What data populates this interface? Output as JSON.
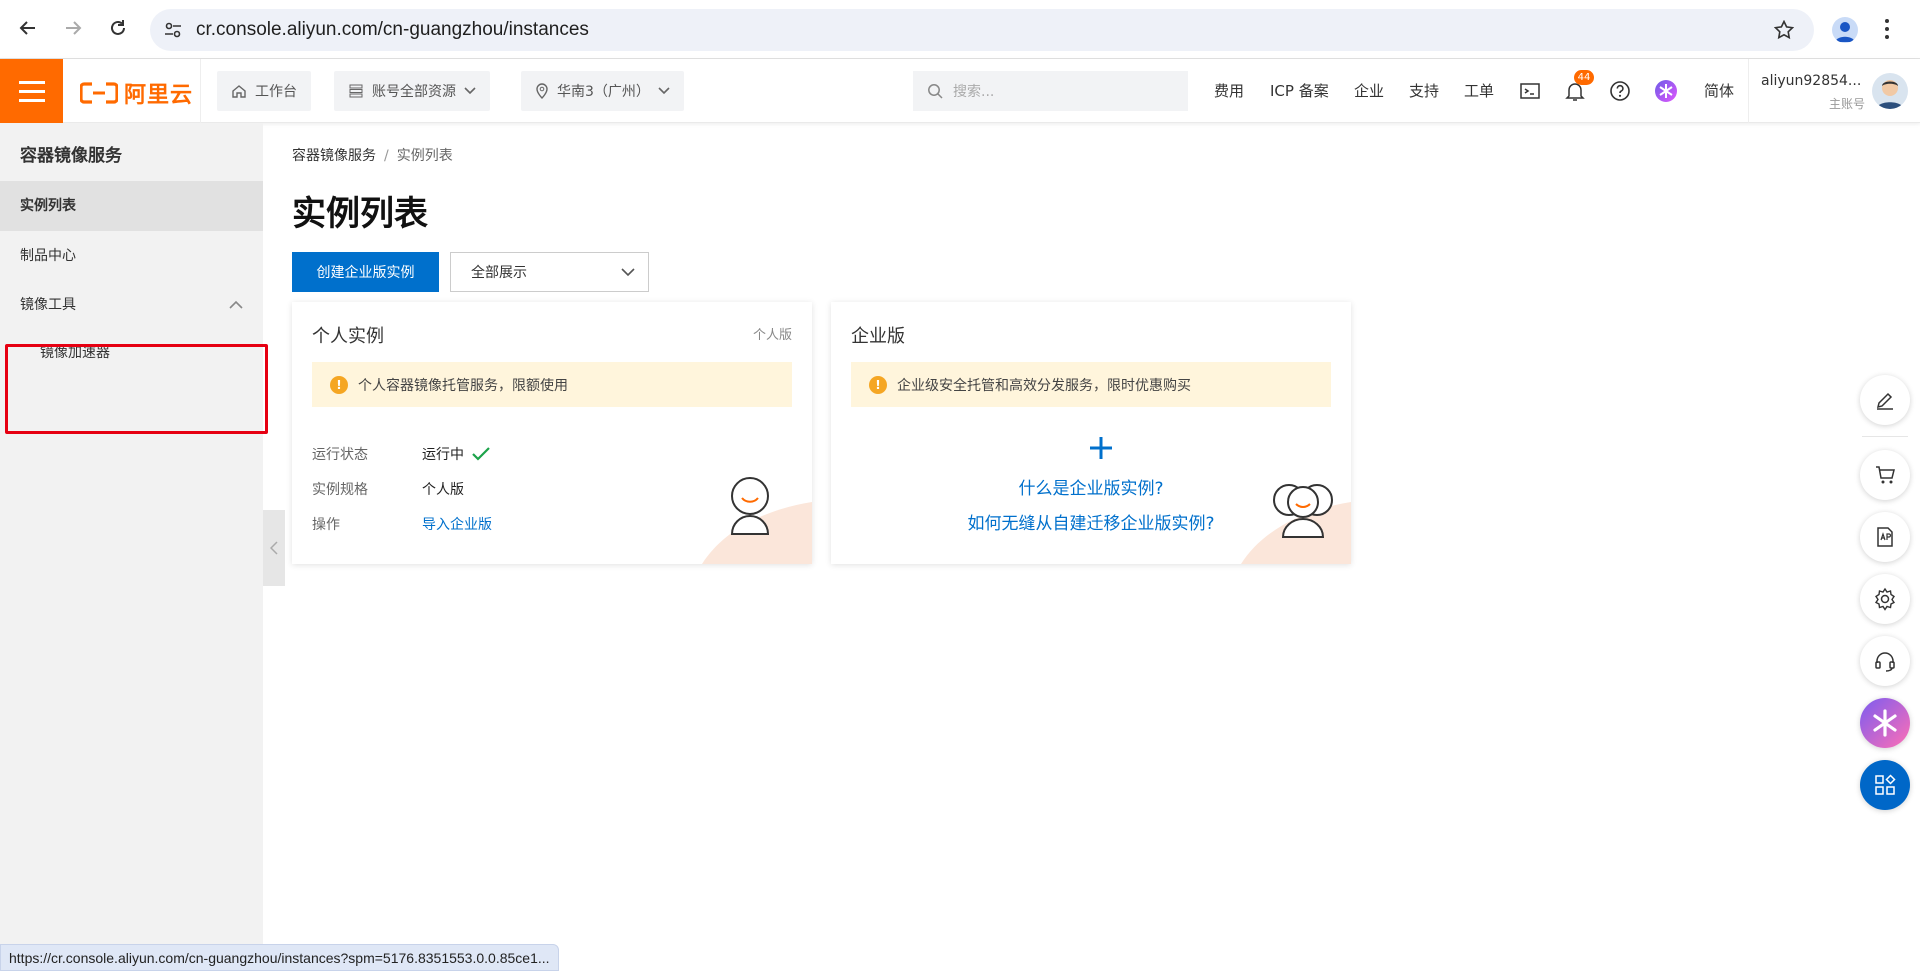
{
  "browser": {
    "url": "cr.console.aliyun.com/cn-guangzhou/instances",
    "status_url": "https://cr.console.aliyun.com/cn-guangzhou/instances?spm=5176.8351553.0.0.85ce1..."
  },
  "topbar": {
    "logo_text": "阿里云",
    "workbench": "工作台",
    "resources": "账号全部资源",
    "region": "华南3（广州）",
    "search_placeholder": "搜索...",
    "links": {
      "fee": "费用",
      "icp": "ICP 备案",
      "enterprise": "企业",
      "support": "支持",
      "ticket": "工单",
      "lang": "简体"
    },
    "notification_count": "44",
    "account_name": "aliyun92854...",
    "account_type": "主账号"
  },
  "sidebar": {
    "title": "容器镜像服务",
    "items": [
      {
        "label": "实例列表"
      },
      {
        "label": "制品中心"
      },
      {
        "label": "镜像工具"
      },
      {
        "label": "镜像加速器"
      }
    ]
  },
  "main": {
    "breadcrumb": [
      "容器镜像服务",
      "实例列表"
    ],
    "title": "实例列表",
    "create_button": "创建企业版实例",
    "filter_value": "全部展示",
    "personal_card": {
      "title": "个人实例",
      "tag": "个人版",
      "notice": "个人容器镜像托管服务，限额使用",
      "rows": [
        {
          "key": "运行状态",
          "value": "运行中"
        },
        {
          "key": "实例规格",
          "value": "个人版"
        },
        {
          "key": "操作",
          "value": "导入企业版"
        }
      ]
    },
    "enterprise_card": {
      "title": "企业版",
      "notice": "企业级安全托管和高效分发服务，限时优惠购买",
      "link1": "什么是企业版实例?",
      "link2": "如何无缝从自建迁移企业版实例?"
    }
  },
  "colors": {
    "brand_orange": "#ff6a00",
    "primary_blue": "#0070cc",
    "highlight_red": "#e60012"
  }
}
